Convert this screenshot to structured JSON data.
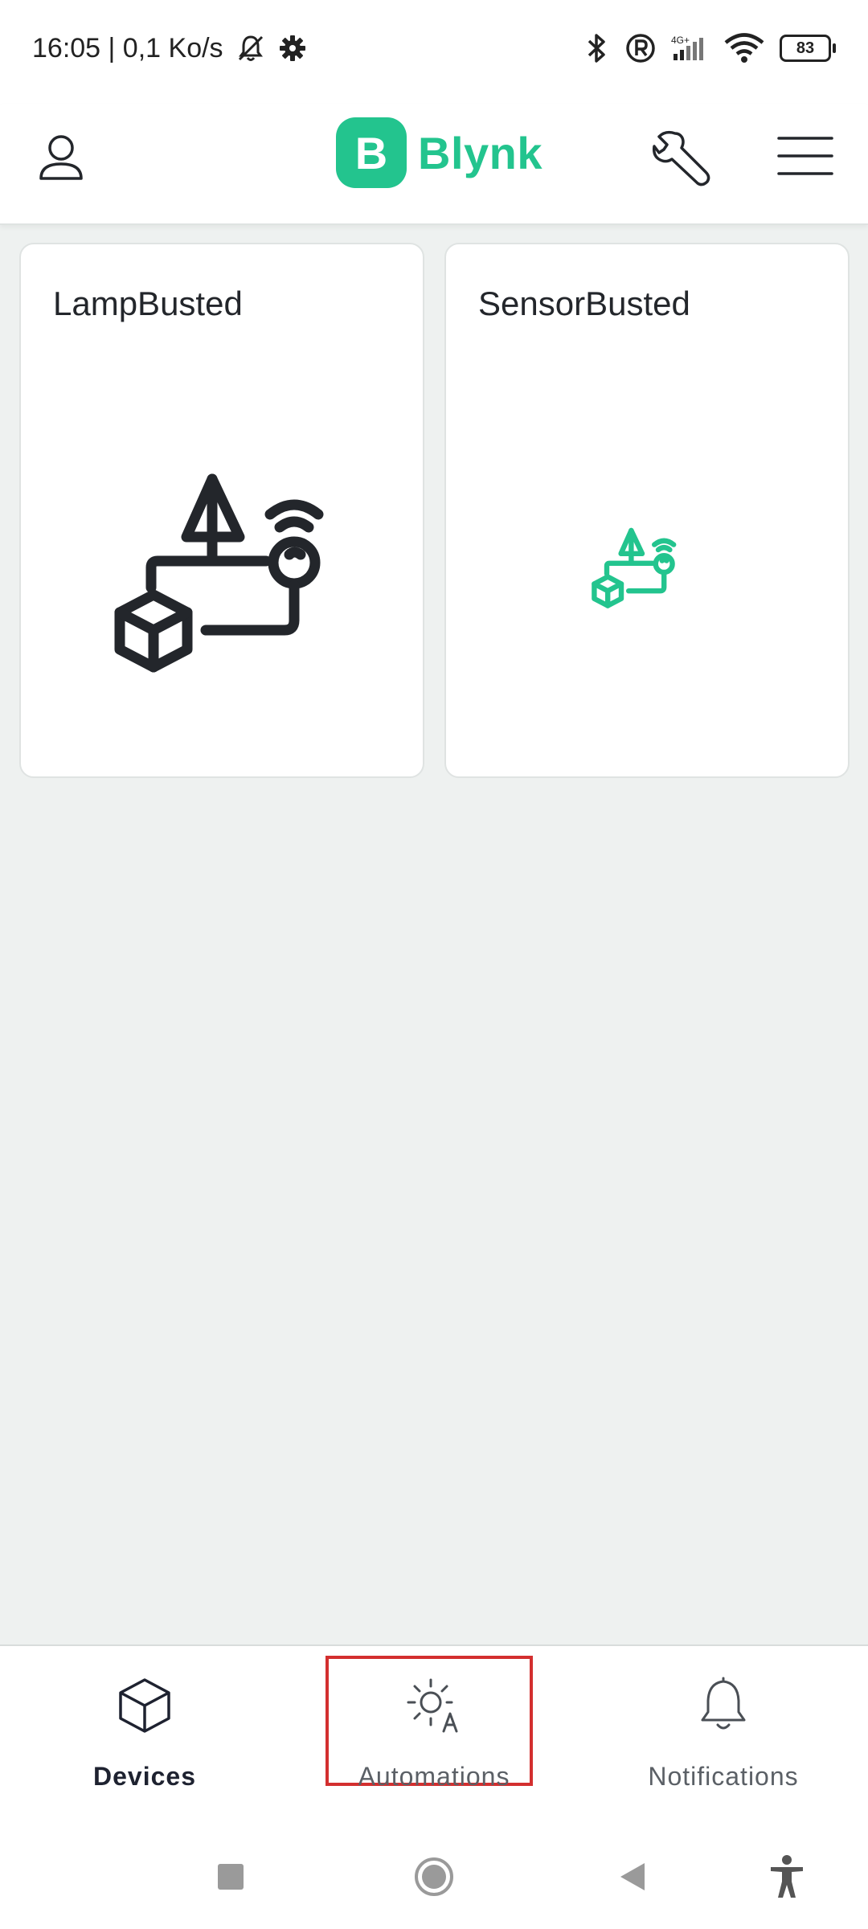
{
  "status_bar": {
    "time_speed": "16:05 | 0,1 Ko/s",
    "network_label": "4G+",
    "battery_level": "83",
    "icons": [
      "bell-off-icon",
      "gear-icon",
      "bluetooth-icon",
      "registered-icon",
      "signal-icon",
      "wifi-icon",
      "battery-icon"
    ]
  },
  "header": {
    "logo_letter": "B",
    "logo_text": "Blynk",
    "brand_color": "#23c48e",
    "icons": [
      "profile-icon",
      "wrench-icon",
      "menu-icon"
    ]
  },
  "devices": [
    {
      "name": "LampBusted",
      "icon": "device-template-icon",
      "icon_color": "#23262b"
    },
    {
      "name": "SensorBusted",
      "icon": "device-template-icon",
      "icon_color": "#23c48e"
    }
  ],
  "bottom_nav": {
    "items": [
      {
        "label": "Devices",
        "icon": "cube-icon",
        "active": true
      },
      {
        "label": "Automations",
        "icon": "automation-sun-icon",
        "active": false,
        "highlighted": true
      },
      {
        "label": "Notifications",
        "icon": "bell-icon",
        "active": false
      }
    ],
    "highlight_color": "#d32f2f"
  },
  "system_nav": {
    "icons": [
      "recents-icon",
      "home-icon",
      "back-icon",
      "accessibility-icon"
    ]
  }
}
